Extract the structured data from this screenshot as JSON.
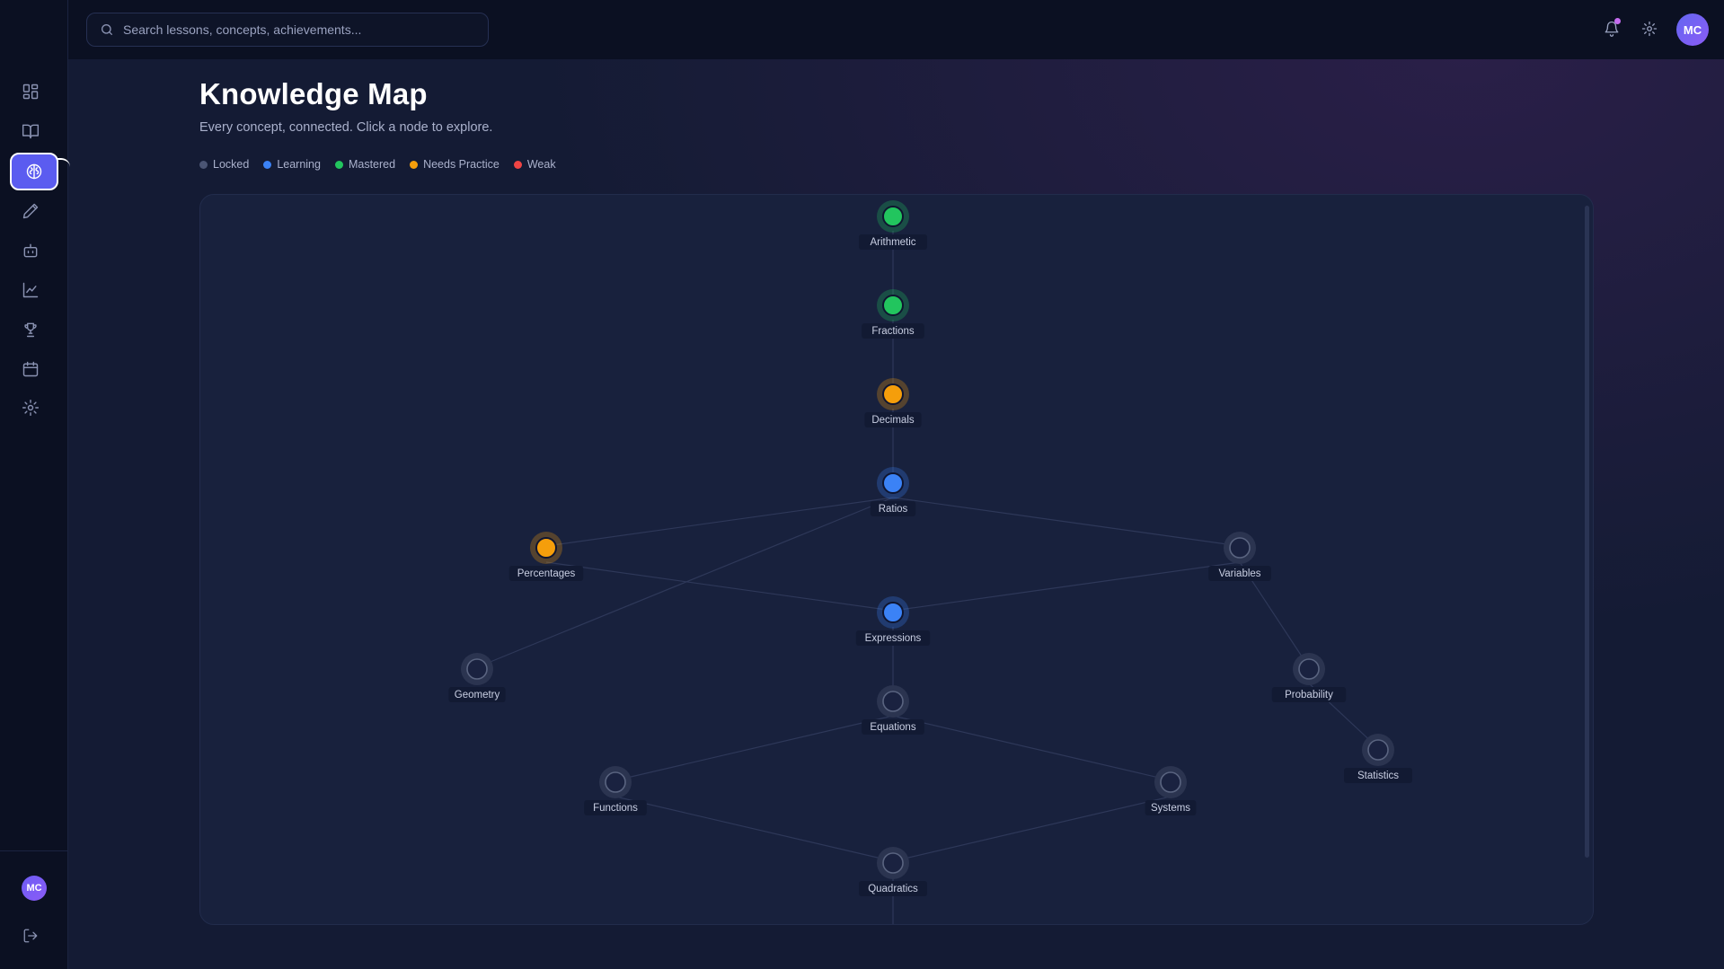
{
  "search": {
    "placeholder": "Search lessons, concepts, achievements..."
  },
  "user": {
    "initials": "MC"
  },
  "header": {
    "title": "Knowledge Map",
    "subtitle": "Every concept, connected. Click a node to explore."
  },
  "legend": [
    {
      "label": "Locked",
      "color": "#4b5574"
    },
    {
      "label": "Learning",
      "color": "#3b82f6"
    },
    {
      "label": "Mastered",
      "color": "#22c55e"
    },
    {
      "label": "Needs Practice",
      "color": "#f59e0b"
    },
    {
      "label": "Weak",
      "color": "#ef4444"
    }
  ],
  "status_colors": {
    "locked": "#3a4461",
    "learning": "#3b82f6",
    "mastered": "#22c55e",
    "needs_practice": "#f59e0b"
  },
  "nodes": [
    {
      "id": "arithmetic",
      "label": "Arithmetic",
      "status": "mastered"
    },
    {
      "id": "fractions",
      "label": "Fractions",
      "status": "mastered"
    },
    {
      "id": "decimals",
      "label": "Decimals",
      "status": "needs_practice"
    },
    {
      "id": "ratios",
      "label": "Ratios",
      "status": "learning"
    },
    {
      "id": "percentages",
      "label": "Percentages",
      "status": "needs_practice"
    },
    {
      "id": "variables",
      "label": "Variables",
      "status": "locked"
    },
    {
      "id": "expressions",
      "label": "Expressions",
      "status": "learning"
    },
    {
      "id": "geometry",
      "label": "Geometry",
      "status": "locked"
    },
    {
      "id": "probability",
      "label": "Probability",
      "status": "locked"
    },
    {
      "id": "equations",
      "label": "Equations",
      "status": "locked"
    },
    {
      "id": "statistics",
      "label": "Statistics",
      "status": "locked"
    },
    {
      "id": "functions",
      "label": "Functions",
      "status": "locked"
    },
    {
      "id": "systems",
      "label": "Systems",
      "status": "locked"
    },
    {
      "id": "quadratics",
      "label": "Quadratics",
      "status": "locked"
    }
  ],
  "edges": [
    [
      "arithmetic",
      "fractions"
    ],
    [
      "fractions",
      "decimals"
    ],
    [
      "decimals",
      "ratios"
    ],
    [
      "ratios",
      "percentages"
    ],
    [
      "ratios",
      "variables"
    ],
    [
      "ratios",
      "geometry"
    ],
    [
      "percentages",
      "expressions"
    ],
    [
      "variables",
      "expressions"
    ],
    [
      "expressions",
      "equations"
    ],
    [
      "variables",
      "probability"
    ],
    [
      "probability",
      "statistics"
    ],
    [
      "equations",
      "functions"
    ],
    [
      "equations",
      "systems"
    ],
    [
      "functions",
      "quadratics"
    ],
    [
      "systems",
      "quadratics"
    ]
  ]
}
